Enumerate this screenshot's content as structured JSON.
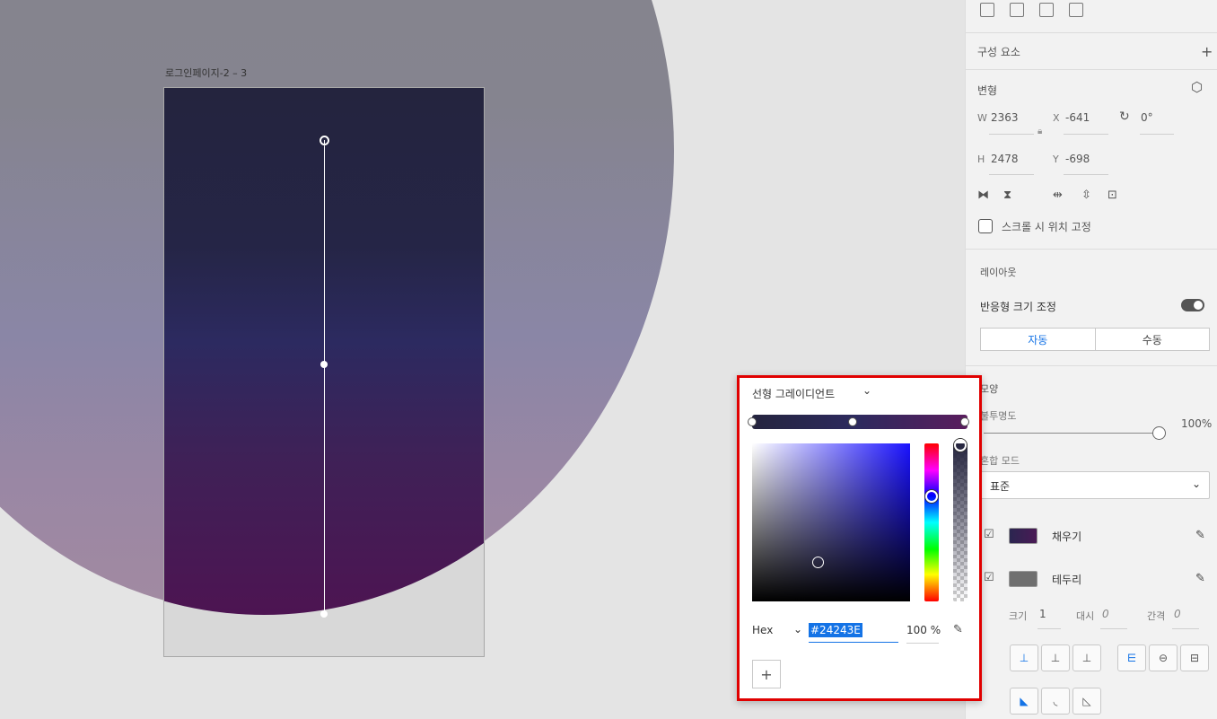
{
  "canvas": {
    "artboard_label": "로그인페이지-2 – 3"
  },
  "panel": {
    "components_label": "구성 요소",
    "add_icon": "+",
    "transform_label": "변형",
    "w_label": "W",
    "w_value": "2363",
    "x_label": "X",
    "x_value": "-641",
    "rotation_value": "0°",
    "h_label": "H",
    "h_value": "2478",
    "y_label": "Y",
    "y_value": "-698",
    "fix_position_label": "스크롤 시 위치 고정",
    "layout_label": "레이아웃",
    "responsive_label": "반응형 크기 조정",
    "auto_label": "자동",
    "manual_label": "수동",
    "appearance_label": "모양",
    "opacity_label": "불투명도",
    "opacity_value": "100%",
    "blend_label": "혼합 모드",
    "blend_value": "표준",
    "fill_label": "채우기",
    "stroke_label": "테두리",
    "size_label": "크기",
    "size_value": "1",
    "dash_label": "대시",
    "dash_value": "0",
    "gap_label": "간격",
    "gap_value": "0",
    "colors": {
      "accent": "#1473e6",
      "fill_start": "#24243e",
      "fill_end": "#4d1452"
    }
  },
  "popover": {
    "gradient_type": "선형 그레이디언트",
    "hex_mode": "Hex",
    "hex_value": "#24243E",
    "alpha_value": "100 %",
    "border_color": "#e00000"
  }
}
